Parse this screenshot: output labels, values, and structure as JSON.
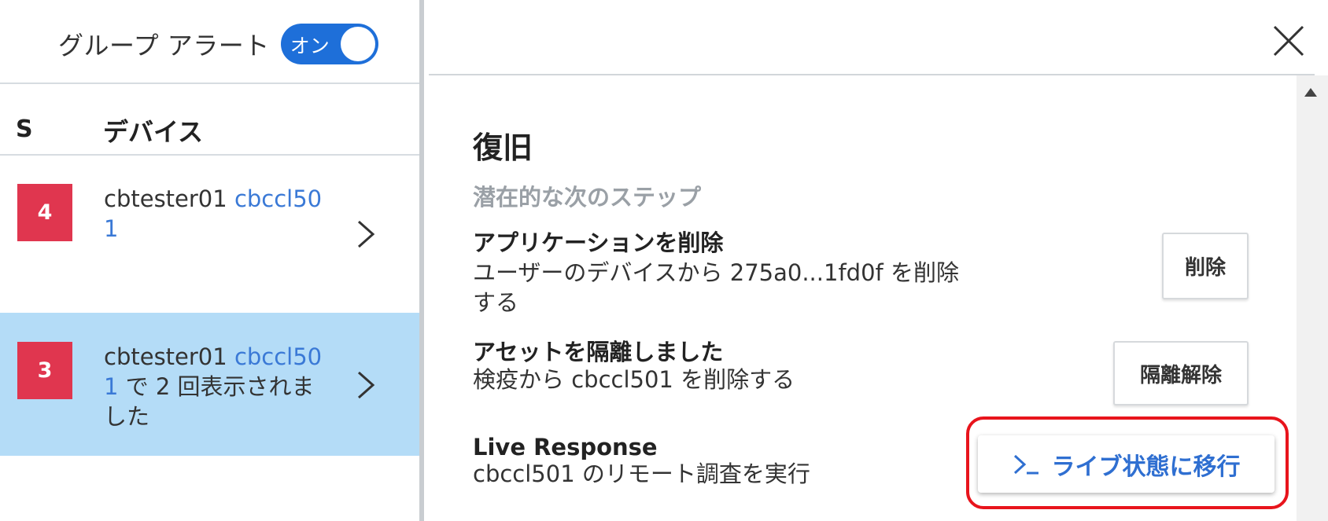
{
  "left_panel": {
    "group_alert_label": "グループ アラート",
    "toggle_label": "オン",
    "columns": {
      "severity": "S",
      "device": "デバイス"
    },
    "rows": [
      {
        "severity": "4",
        "user": "cbtester01",
        "device": "cbccl50 1",
        "suffix": ""
      },
      {
        "severity": "3",
        "user": "cbtester01",
        "device": "cbccl50 1",
        "suffix": "で 2 回表示されました"
      }
    ]
  },
  "right_panel": {
    "section_title": "復旧",
    "section_subtitle": "潜在的な次のステップ",
    "items": [
      {
        "title": "アプリケーションを削除",
        "description": "ユーザーのデバイスから 275a0...1fd0f を削除する",
        "button": "削除"
      },
      {
        "title": "アセットを隔離しました",
        "description": "検疫から cbccl501 を削除する",
        "button": "隔離解除"
      },
      {
        "title": "Live Response",
        "description": "cbccl501 のリモート調査を実行",
        "button": "ライブ状態に移行"
      }
    ]
  },
  "colors": {
    "toggle_on": "#1e6fd9",
    "severity_badge": "#e0364f",
    "selected_row": "#b4dcf7",
    "link_blue": "#3a79d6",
    "highlight_outline": "#e8141c"
  },
  "icons": {
    "close": "close-icon",
    "chevron": "chevron-right-icon",
    "terminal": "terminal-icon"
  }
}
